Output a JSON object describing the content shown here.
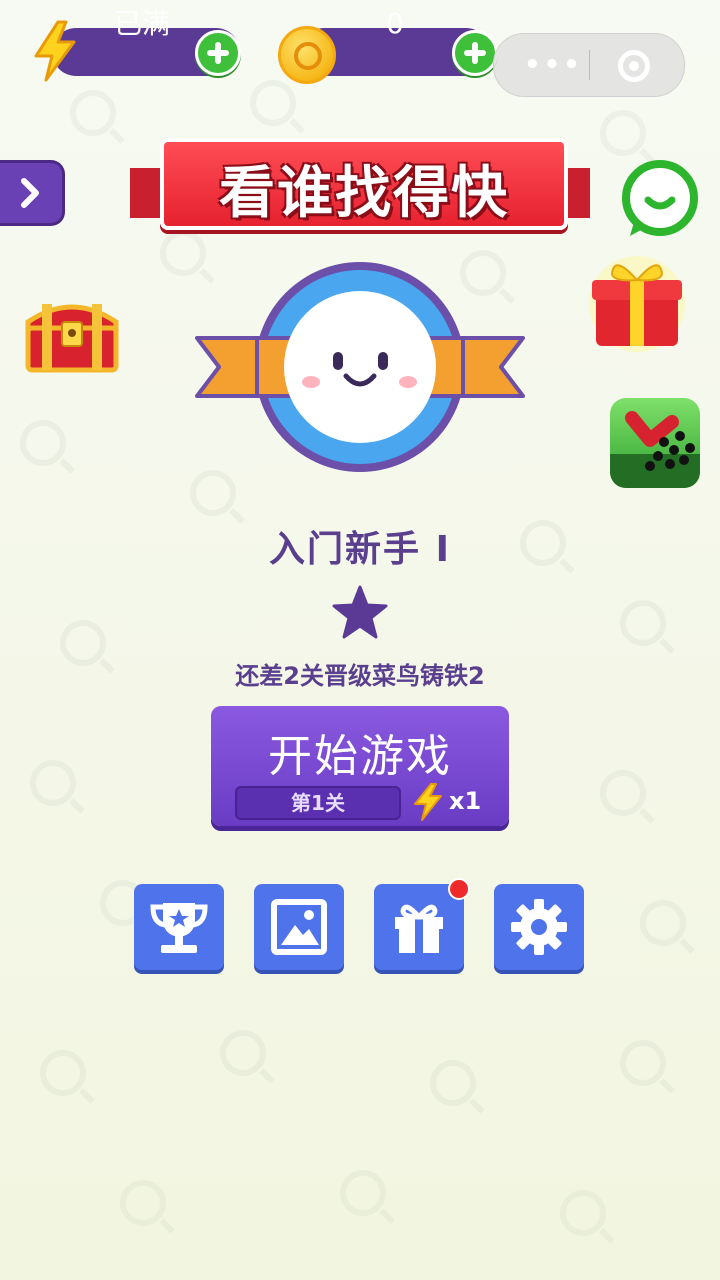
{
  "top_bar": {
    "energy_value": "已满",
    "coin_value": "0"
  },
  "title_banner": "看谁找得快",
  "rank": {
    "name": "入门新手 Ⅰ",
    "progress_text": "还差2关晋级菜鸟铸铁2",
    "stars": 1
  },
  "start_button": {
    "label": "开始游戏",
    "level": "第1关",
    "cost": "x1"
  },
  "bottom_buttons": [
    {
      "icon": "trophy-icon",
      "has_badge": false
    },
    {
      "icon": "image-icon",
      "has_badge": false
    },
    {
      "icon": "gift-icon",
      "has_badge": true
    },
    {
      "icon": "gear-icon",
      "has_badge": false
    }
  ],
  "side_items": {
    "left": [
      "arrow-right-icon",
      "treasure-chest-icon"
    ],
    "right": [
      "chat-icon",
      "gift-box-icon",
      "app-promo-icon"
    ]
  },
  "colors": {
    "primary_purple": "#6a3cc4",
    "button_blue": "#4f73ea",
    "banner_red": "#e6222f",
    "plus_green": "#3ec03a",
    "text_purple": "#5a3f8f"
  }
}
